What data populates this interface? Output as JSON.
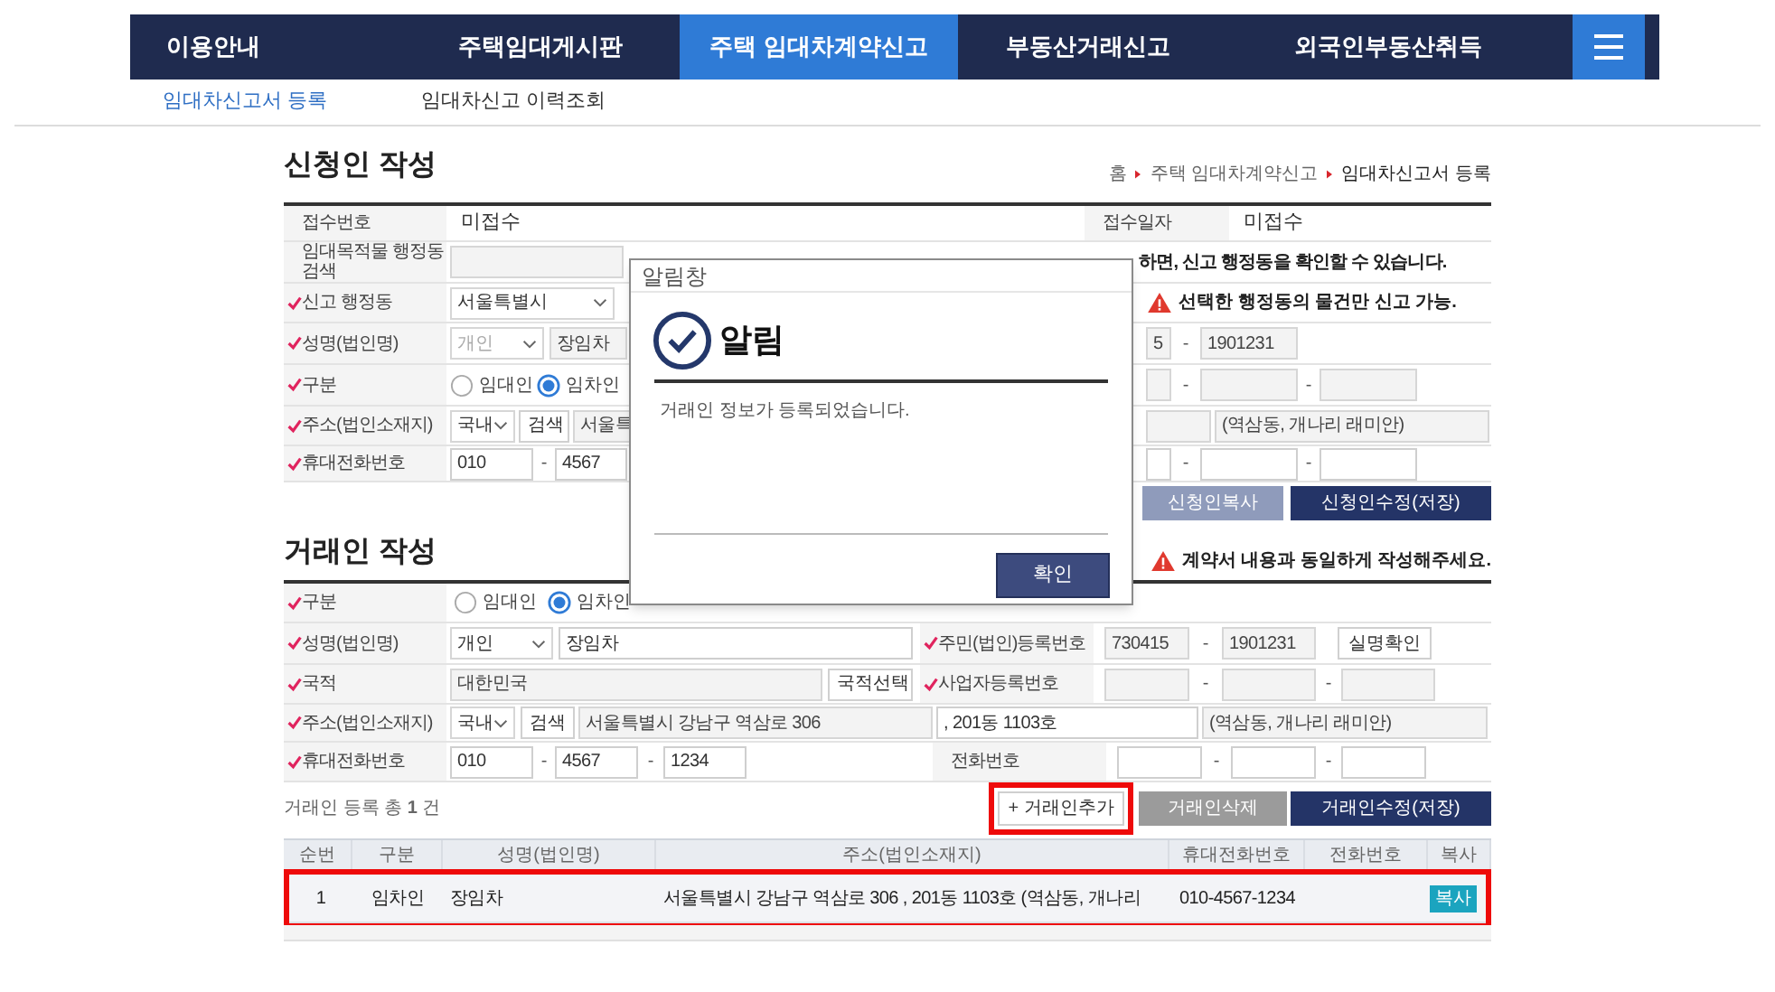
{
  "nav": {
    "items": [
      {
        "label": "이용안내",
        "selected": false
      },
      {
        "label": "주택임대게시판",
        "selected": false
      },
      {
        "label": "주택 임대차계약신고",
        "selected": true
      },
      {
        "label": "부동산거래신고",
        "selected": false
      },
      {
        "label": "외국인부동산취득",
        "selected": false
      }
    ]
  },
  "subnav": [
    {
      "label": "임대차신고서 등록",
      "selected": true
    },
    {
      "label": "임대차신고 이력조회",
      "selected": false
    }
  ],
  "applicant": {
    "title": "신청인 작성",
    "breadcrumb": [
      "홈",
      "주택 임대차계약신고",
      "임대차신고서 등록"
    ],
    "rows": [
      {
        "left": [
          {
            "kind": "label",
            "text": "접수번호",
            "required": false
          },
          {
            "kind": "text",
            "text": "미접수"
          },
          {
            "kind": "label",
            "text": "접수일자",
            "required": false
          },
          {
            "kind": "text",
            "text": "미접수"
          }
        ],
        "right": []
      },
      {
        "left": [
          {
            "kind": "label",
            "text": "임대목적물 행정동 검색",
            "required": false
          },
          {
            "kind": "field",
            "readonly": true
          }
        ],
        "right": [
          {
            "kind": "note",
            "text": "하면, 신고 행정동을 확인할 수 있습니다."
          }
        ]
      },
      {
        "left": [
          {
            "kind": "label",
            "text": "신고 행정동",
            "required": true
          },
          {
            "kind": "select",
            "text": "서울특별시",
            "disabled": false
          }
        ],
        "right": [
          {
            "kind": "warning",
            "text": "선택한 행정동의 물건만 신고 가능."
          }
        ]
      },
      {
        "left": [
          {
            "kind": "label",
            "text": "성명(법인명)",
            "required": true
          },
          {
            "kind": "select",
            "text": "개인",
            "disabled": true
          },
          {
            "kind": "field",
            "text": "장임차",
            "readonly": true
          }
        ],
        "right": [
          {
            "kind": "field",
            "text": "5",
            "readonly": true
          },
          {
            "kind": "dash",
            "text": "-"
          },
          {
            "kind": "field",
            "text": "1901231",
            "readonly": true
          }
        ]
      },
      {
        "left": [
          {
            "kind": "label",
            "text": "구분",
            "required": true
          },
          {
            "kind": "radio",
            "text": "임대인",
            "selected": false
          },
          {
            "kind": "radio",
            "text": "임차인",
            "selected": true
          }
        ],
        "right": [
          {
            "kind": "field",
            "readonly": true
          },
          {
            "kind": "dash",
            "text": "-"
          },
          {
            "kind": "field",
            "readonly": true
          },
          {
            "kind": "dash",
            "text": "-"
          },
          {
            "kind": "field",
            "readonly": true
          }
        ]
      },
      {
        "left": [
          {
            "kind": "label",
            "text": "주소(법인소재지)",
            "required": true
          },
          {
            "kind": "select",
            "text": "국내",
            "disabled": false
          },
          {
            "kind": "button",
            "text": "검색"
          },
          {
            "kind": "field",
            "text": "서울특",
            "readonly": true
          }
        ],
        "right": [
          {
            "kind": "field",
            "readonly": true
          },
          {
            "kind": "field",
            "text": "(역삼동, 개나리 래미안)",
            "readonly": true
          }
        ]
      },
      {
        "left": [
          {
            "kind": "label",
            "text": "휴대전화번호",
            "required": true
          },
          {
            "kind": "field",
            "text": "010",
            "readonly": false
          },
          {
            "kind": "dash",
            "text": "-"
          },
          {
            "kind": "field",
            "text": "4567",
            "readonly": false
          }
        ],
        "right": [
          {
            "kind": "field",
            "readonly": false
          },
          {
            "kind": "dash",
            "text": "-"
          },
          {
            "kind": "field",
            "readonly": false
          },
          {
            "kind": "dash",
            "text": "-"
          },
          {
            "kind": "field",
            "readonly": false
          }
        ]
      }
    ],
    "buttons": [
      {
        "label": "신청인복사",
        "kind": "secondary"
      },
      {
        "label": "신청인수정(저장)",
        "kind": "primary"
      }
    ]
  },
  "dialog": {
    "title": "알림창",
    "heading": "알림",
    "message": "거래인 정보가 등록되었습니다.",
    "button": "확인"
  },
  "counterparty": {
    "title": "거래인 작성",
    "warning": "계약서 내용과 동일하게 작성해주세요.",
    "rows": [
      [
        {
          "label": {
            "text": "구분",
            "required": true
          },
          "controls": [
            {
              "kind": "radio",
              "text": "임대인",
              "selected": false
            },
            {
              "kind": "radio",
              "text": "임차인",
              "selected": true
            }
          ]
        }
      ],
      [
        {
          "label": {
            "text": "성명(법인명)",
            "required": true
          },
          "controls": [
            {
              "kind": "select",
              "text": "개인",
              "disabled": false
            },
            {
              "kind": "field",
              "text": "장임차",
              "readonly": false
            }
          ]
        },
        {
          "label": {
            "text": "주민(법인)등록번호",
            "required": true
          },
          "controls": [
            {
              "kind": "field",
              "text": "730415",
              "readonly": true
            },
            {
              "kind": "dash",
              "text": "-"
            },
            {
              "kind": "field",
              "text": "1901231",
              "readonly": true
            },
            {
              "kind": "button",
              "text": "실명확인"
            }
          ]
        }
      ],
      [
        {
          "label": {
            "text": "국적",
            "required": true
          },
          "controls": [
            {
              "kind": "field",
              "text": "대한민국",
              "readonly": true
            },
            {
              "kind": "button",
              "text": "국적선택"
            }
          ]
        },
        {
          "label": {
            "text": "사업자등록번호",
            "required": true
          },
          "controls": [
            {
              "kind": "field",
              "readonly": true
            },
            {
              "kind": "dash",
              "text": "-"
            },
            {
              "kind": "field",
              "readonly": true
            },
            {
              "kind": "dash",
              "text": "-"
            },
            {
              "kind": "field",
              "readonly": true
            }
          ]
        }
      ],
      [
        {
          "label": {
            "text": "주소(법인소재지)",
            "required": true
          },
          "controls": [
            {
              "kind": "select",
              "text": "국내",
              "disabled": false
            },
            {
              "kind": "button",
              "text": "검색"
            },
            {
              "kind": "field",
              "text": "서울특별시 강남구 역삼로 306",
              "readonly": true
            },
            {
              "kind": "field",
              "text": ", 201동 1103호",
              "readonly": false
            },
            {
              "kind": "field",
              "text": "(역삼동, 개나리 래미안)",
              "readonly": true
            }
          ]
        }
      ],
      [
        {
          "label": {
            "text": "휴대전화번호",
            "required": true
          },
          "controls": [
            {
              "kind": "field",
              "text": "010",
              "readonly": false
            },
            {
              "kind": "dash",
              "text": "-"
            },
            {
              "kind": "field",
              "text": "4567",
              "readonly": false
            },
            {
              "kind": "dash",
              "text": "-"
            },
            {
              "kind": "field",
              "text": "1234",
              "readonly": false
            }
          ]
        },
        {
          "label": {
            "text": "전화번호",
            "required": false
          },
          "controls": [
            {
              "kind": "field",
              "readonly": false
            },
            {
              "kind": "dash",
              "text": "-"
            },
            {
              "kind": "field",
              "readonly": false
            },
            {
              "kind": "dash",
              "text": "-"
            },
            {
              "kind": "field",
              "readonly": false
            }
          ]
        }
      ]
    ],
    "count": "거래인 등록 총 **1** 건",
    "buttons": [
      {
        "label": "+ 거래인추가",
        "kind": "outline",
        "highlighted": true
      },
      {
        "label": "거래인삭제",
        "kind": "gray",
        "highlighted": false
      },
      {
        "label": "거래인수정(저장)",
        "kind": "primary",
        "highlighted": false
      }
    ],
    "table": {
      "columns": [
        "순번",
        "구분",
        "성명(법인명)",
        "주소(법인소재지)",
        "휴대전화번호",
        "전화번호",
        "복사"
      ],
      "rows": [
        {
          "no": "1",
          "type": "임차인",
          "name": "장임차",
          "address": "서울특별시 강남구 역삼로 306 , 201동 1103호  (역삼동, 개나리",
          "mobile": "010-4567-1234",
          "copy_button": "복사",
          "highlighted": true
        }
      ]
    }
  }
}
